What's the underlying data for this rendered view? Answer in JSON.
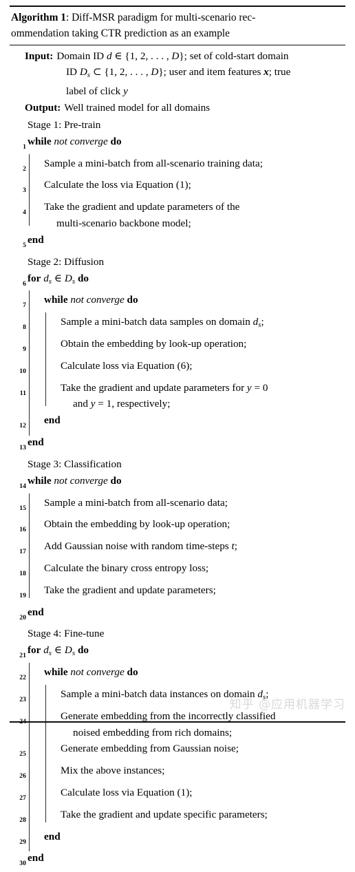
{
  "figure": {
    "label": "Algorithm 1",
    "separator": ": ",
    "title_line1": "Diff-MSR paradigm for multi-scenario rec-",
    "title_line2": "ommendation taking CTR prediction as an example"
  },
  "io": {
    "input_label": "Input:",
    "input_line1": "Domain ID d ∈ {1, 2, . . . , D}; set of cold-start domain",
    "input_line2": "ID D_s ⊂ {1, 2, . . . , D}; user and item features x; true",
    "input_line3": "label of click y",
    "output_label": "Output:",
    "output_value": "Well trained model for all domains"
  },
  "stages": {
    "stage1": "Stage 1: Pre-train",
    "stage2": "Stage 2: Diffusion",
    "stage3": "Stage 3: Classification",
    "stage4": "Stage 4: Fine-tune"
  },
  "lines": {
    "n1": "1",
    "n2": "2",
    "n3": "3",
    "n4": "4",
    "n5": "5",
    "n6": "6",
    "n7": "7",
    "n8": "8",
    "n9": "9",
    "n10": "10",
    "n11": "11",
    "n12": "12",
    "n13": "13",
    "n14": "14",
    "n15": "15",
    "n16": "16",
    "n17": "17",
    "n18": "18",
    "n19": "19",
    "n20": "20",
    "n21": "21",
    "n22": "22",
    "n23": "23",
    "n24": "24",
    "n25": "25",
    "n26": "26",
    "n27": "27",
    "n28": "28",
    "n29": "29",
    "n30": "30"
  },
  "keywords": {
    "while": "while",
    "for": "for",
    "do": "do",
    "end": "end",
    "not_converge": "not converge"
  },
  "body": {
    "l2": "Sample a mini-batch from all-scenario training data;",
    "l3": "Calculate the loss via Equation (1);",
    "l4a": "Take the gradient and update parameters of the",
    "l4b": "multi-scenario backbone model;",
    "l8": "Sample a mini-batch data samples on domain",
    "l8_tail": ";",
    "l9": "Obtain the embedding by look-up operation;",
    "l10": "Calculate loss via Equation (6);",
    "l11a_pre": "Take the gradient and update parameters for",
    "l11a_eq": " = 0",
    "l11b_pre": "and",
    "l11b_eq": " = 1, respectively;",
    "l15": "Sample a mini-batch from all-scenario data;",
    "l16": "Obtain the embedding by look-up operation;",
    "l17": "Add Gaussian noise with random time-steps",
    "l17_tail": ";",
    "l18": "Calculate the binary cross entropy loss;",
    "l19": "Take the gradient and update parameters;",
    "l23": "Sample a mini-batch data instances on domain",
    "l23_tail": ";",
    "l24a": "Generate embedding from the incorrectly classified",
    "l24b": "noised embedding from rich domains;",
    "l25": "Generate embedding from Gaussian noise;",
    "l26": "Mix the above instances;",
    "l27": "Calculate loss via Equation (1);",
    "l28": "Take the gradient and update specific parameters;"
  },
  "symbols": {
    "d": "d",
    "ds_base": "d",
    "ds_sub": "s",
    "Ds_base": "D",
    "Ds_sub": "s",
    "in": "∈",
    "y": "y",
    "t": "t"
  },
  "watermark": {
    "text": "知乎 @应用机器学习"
  },
  "colors": {
    "rule": "#0d0d0d",
    "text": "#000000",
    "indent_bar": "#2a2a2a",
    "watermark": "#d9d9d9",
    "background": "#ffffff"
  }
}
